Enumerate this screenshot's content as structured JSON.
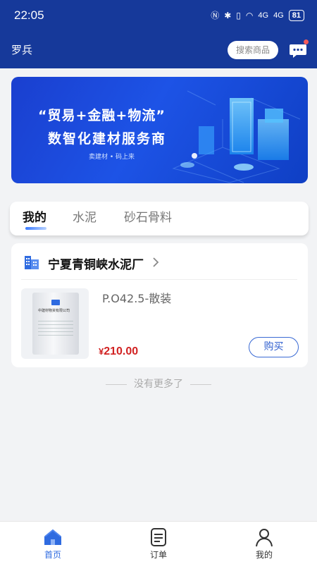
{
  "status_bar": {
    "time": "22:05",
    "battery": "81",
    "signal_1": "4G",
    "signal_2": "4G"
  },
  "header": {
    "user_name": "罗兵",
    "search_label": "搜索商品",
    "message_icon": "message-icon"
  },
  "banner": {
    "slogan": "“贸易+金融+物流”",
    "title": "数智化建材服务商",
    "subtitle": "卖建材 • 码上来"
  },
  "tabs": [
    {
      "label": "我的",
      "active": true
    },
    {
      "label": "水泥",
      "active": false
    },
    {
      "label": "砂石骨料",
      "active": false
    }
  ],
  "store": {
    "name": "宁夏青铜峡水泥厂",
    "icon": "building-icon",
    "product": {
      "name": "P.O42.5-散装",
      "currency": "¥",
      "price": "210.00",
      "buy_label": "购买",
      "bag_text": "中建材物资有限公司"
    }
  },
  "footer_hint": "没有更多了",
  "tabbar": [
    {
      "label": "首页",
      "icon": "home-icon",
      "active": true
    },
    {
      "label": "订单",
      "icon": "order-icon",
      "active": false
    },
    {
      "label": "我的",
      "icon": "user-icon",
      "active": false
    }
  ],
  "colors": {
    "header_bg": "#16399a",
    "accent": "#2f6be0",
    "price": "#d12222"
  }
}
